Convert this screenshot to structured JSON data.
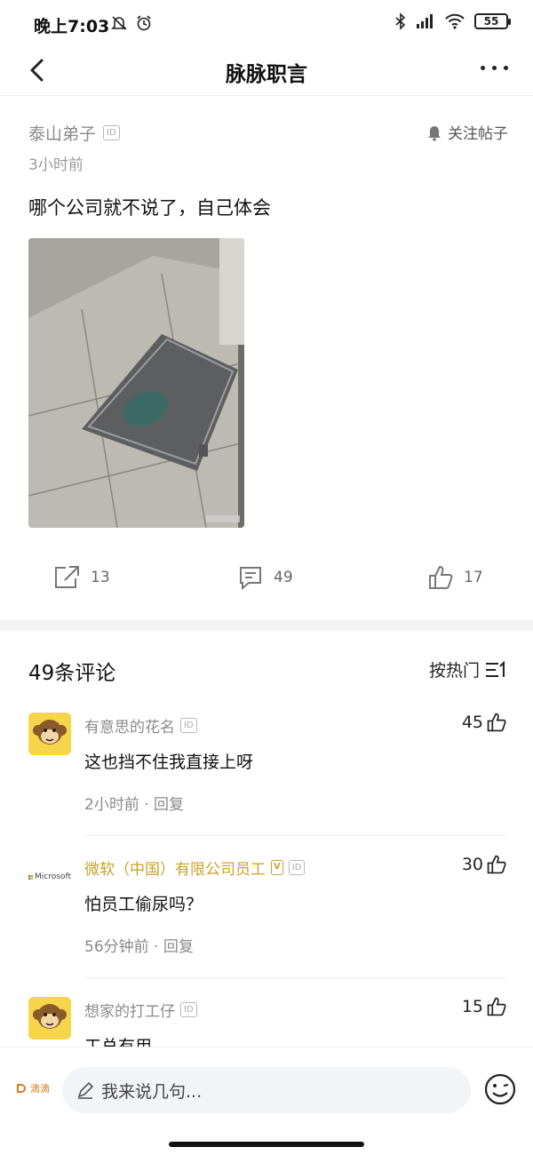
{
  "status_bar": {
    "time": "晚上7:03",
    "battery": "55"
  },
  "nav": {
    "title": "脉脉职言"
  },
  "post": {
    "author": "泰山弟子",
    "id_badge": "ID",
    "time": "3小时前",
    "follow_label": "关注帖子",
    "text": "哪个公司就不说了，自己体会",
    "shares": "13",
    "comments": "49",
    "likes": "17"
  },
  "comments_section": {
    "count_label": "49条评论",
    "sort_label": "按热门",
    "items": [
      {
        "name": "有意思的花名",
        "id_badge": "ID",
        "likes": "45",
        "text": "这也挡不住我直接上呀",
        "time": "2小时前",
        "reply": "回复"
      },
      {
        "name": "微软（中国）有限公司员工",
        "v_badge": "V",
        "id_badge": "ID",
        "avatar_text": "Microsoft",
        "likes": "30",
        "text": "怕员工偷尿吗？",
        "time": "56分钟前",
        "reply": "回复"
      },
      {
        "name": "想家的打工仔",
        "id_badge": "ID",
        "likes": "15",
        "text": "工总有用"
      }
    ]
  },
  "bottom_bar": {
    "logo_text": "滴滴",
    "placeholder": "我来说几句..."
  },
  "colors": {
    "gold": "#c9a227",
    "avatar_yellow": "#f7d54a",
    "divider": "#f4f4f6"
  }
}
